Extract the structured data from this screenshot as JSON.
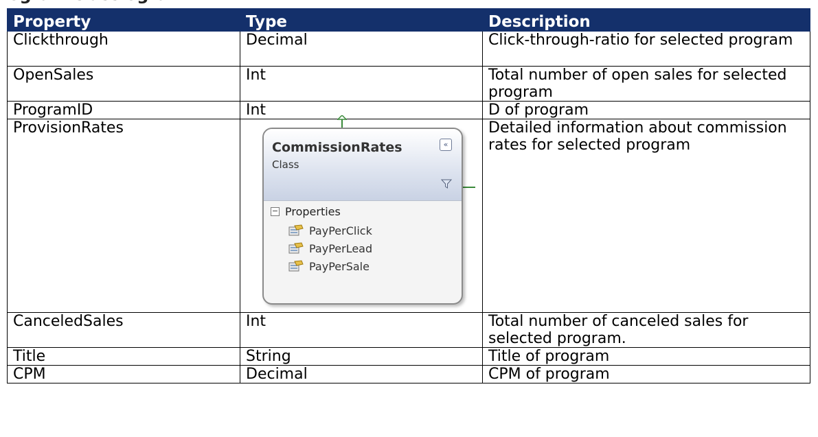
{
  "heading_fragment": "ogram c ass ogra",
  "table": {
    "headers": [
      "Property",
      "Type",
      "Description"
    ],
    "rows": [
      {
        "property": "Clickthrough",
        "type": "Decimal",
        "description": "Click-through-ratio for selected program"
      },
      {
        "property": "OpenSales",
        "type": "Int",
        "description": "Total number of open sales for selected program"
      },
      {
        "property": "ProgramID",
        "type": "Int",
        "description": "D of program"
      },
      {
        "property": "ProvisionRates",
        "type": "",
        "description": "Detailed information about commission rates for selected program"
      },
      {
        "property": "CanceledSales",
        "type": "Int",
        "description": "Total number of canceled sales for selected program."
      },
      {
        "property": "Title",
        "type": "String",
        "description": "Title of program"
      },
      {
        "property": "CPM",
        "type": "Decimal",
        "description": "CPM of program"
      }
    ]
  },
  "diagram": {
    "title": "CommissionRates",
    "subtitle": "Class",
    "section": "Properties",
    "members": [
      "PayPerClick",
      "PayPerLead",
      "PayPerSale"
    ],
    "collapse_glyph": "«",
    "section_toggle_glyph": "−"
  },
  "colors": {
    "header_bg": "#14306b",
    "header_text": "#ffffff",
    "connector": "#3a8a3a"
  }
}
